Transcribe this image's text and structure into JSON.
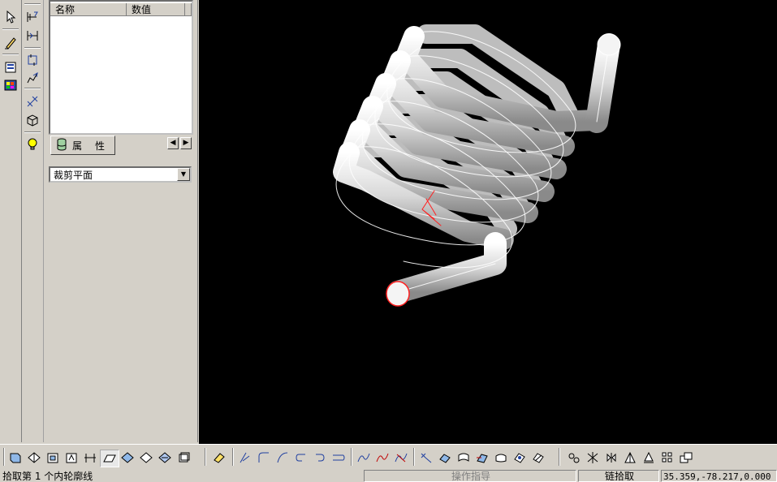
{
  "property_grid": {
    "col_name": "名称",
    "col_value": "数值"
  },
  "tab": {
    "label_a": "属",
    "label_b": "性"
  },
  "clip_combo": {
    "selected": "裁剪平面"
  },
  "status_bar": {
    "prompt": "拾取第 1 个内轮廓线",
    "operation_hint": "操作指导",
    "mode": "链拾取",
    "coordinates": "35.359,-78.217,0.000"
  },
  "icons_left": [
    "select-arrow-icon",
    "sketch-pencil-icon",
    "element-list-icon",
    "color-palette-icon"
  ],
  "icons_left2": [
    "dimension-icon",
    "constraint-icon",
    "loop-icon",
    "edit-curve-icon",
    "axis-icon",
    "cube-box-icon",
    "light-bulb-icon"
  ],
  "colors": {
    "background": "#000000",
    "spring": "#e8e8e8",
    "highlight": "#ff2020",
    "panel": "#d4d0c8"
  }
}
